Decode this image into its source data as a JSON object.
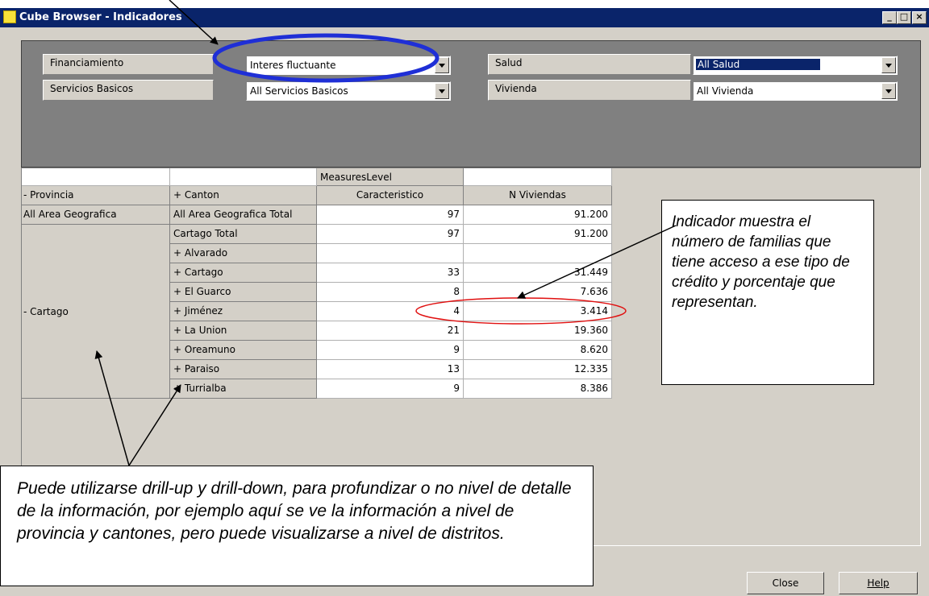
{
  "window": {
    "title": "Cube Browser - Indicadores",
    "controls": {
      "minimize": "_",
      "maximize": "□",
      "close": "×"
    }
  },
  "filters": [
    {
      "label": "Financiamiento",
      "value": "Interes fluctuante"
    },
    {
      "label": "Servicios Basicos",
      "value": "All Servicios Basicos"
    },
    {
      "label": "Salud",
      "value": "All Salud"
    },
    {
      "label": "Vivienda",
      "value": "All Vivienda"
    }
  ],
  "grid": {
    "measures_level": "MeasuresLevel",
    "headers": {
      "provincia": "- Provincia",
      "canton": "+ Canton",
      "caracteristico": "Caracteristico",
      "n_viviendas": "N Viviendas"
    },
    "top_row": {
      "area": "All Area Geografica",
      "label": "All Area Geografica Total",
      "caracteristico": "97",
      "n_viviendas": "91.200"
    },
    "province": "-  Cartago",
    "rows": [
      {
        "canton": "Cartago Total",
        "caracteristico": "97",
        "n_viviendas": "91.200"
      },
      {
        "canton": "+  Alvarado",
        "caracteristico": "",
        "n_viviendas": ""
      },
      {
        "canton": "+  Cartago",
        "caracteristico": "33",
        "n_viviendas": "31.449"
      },
      {
        "canton": "+  El Guarco",
        "caracteristico": "8",
        "n_viviendas": "7.636"
      },
      {
        "canton": "+  Jiménez",
        "caracteristico": "4",
        "n_viviendas": "3.414"
      },
      {
        "canton": "+  La Union",
        "caracteristico": "21",
        "n_viviendas": "19.360"
      },
      {
        "canton": "+  Oreamuno",
        "caracteristico": "9",
        "n_viviendas": "8.620"
      },
      {
        "canton": "+  Paraiso",
        "caracteristico": "13",
        "n_viviendas": "12.335"
      },
      {
        "canton": "+  Turrialba",
        "caracteristico": "9",
        "n_viviendas": "8.386"
      }
    ]
  },
  "callouts": {
    "right": "Indicador muestra el número de familias que tiene acceso a ese tipo de crédito y porcentaje que representan.",
    "bottom": "Puede utilizarse drill-up y drill-down, para profundizar o no nivel de detalle de la información, por ejemplo aquí se ve la información a nivel de provincia y cantones, pero puede visualizarse a nivel de distritos."
  },
  "buttons": {
    "close": "Close",
    "help": "Help"
  },
  "colors": {
    "titlebar": "#0a246a",
    "window": "#d4d0c8",
    "filter_panel": "#808080",
    "highlight_ellipse": "#1f2fd6",
    "row_ellipse": "#e01010"
  }
}
